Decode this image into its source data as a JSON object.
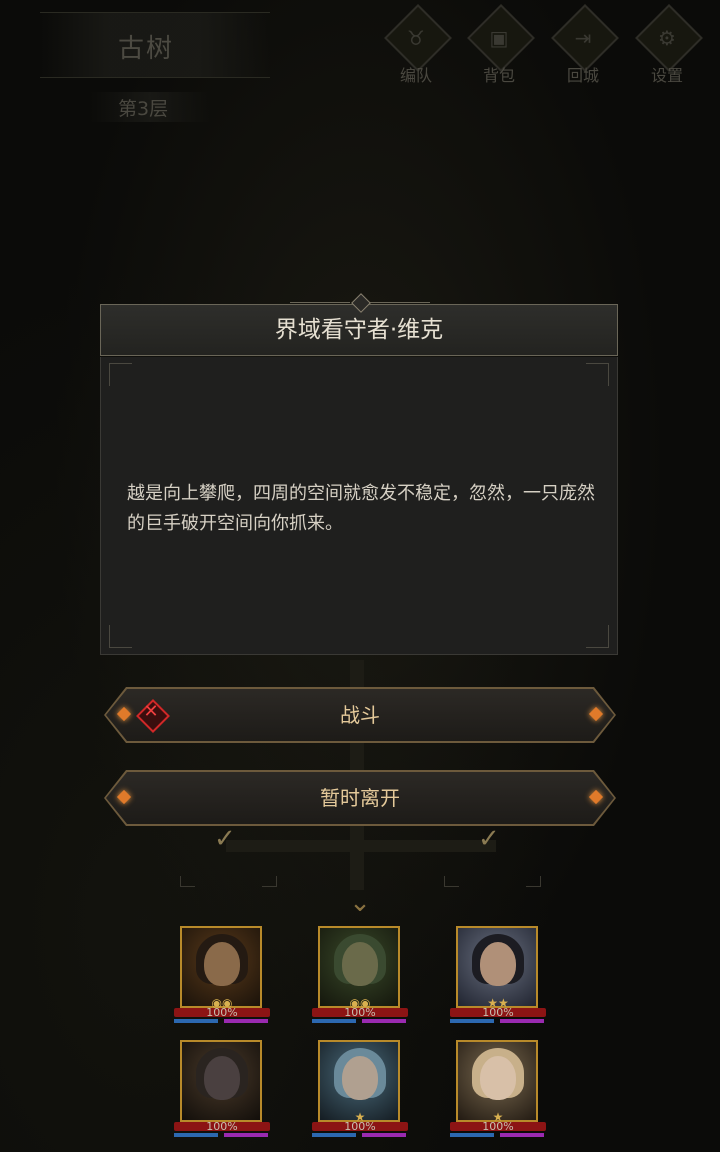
{
  "header": {
    "area_title": "古树",
    "floor": "第3层"
  },
  "menu": [
    {
      "label": "编队",
      "icon": "bull-helmet-icon"
    },
    {
      "label": "背包",
      "icon": "bag-icon"
    },
    {
      "label": "回城",
      "icon": "return-door-icon"
    },
    {
      "label": "设置",
      "icon": "gear-icon"
    }
  ],
  "dialog": {
    "title": "界域看守者·维克",
    "text": "越是向上攀爬，四周的空间就愈发不稳定，忽然，一只庞然的巨手破开空间向你抓来。"
  },
  "actions": {
    "fight": "战斗",
    "leave": "暂时离开"
  },
  "team": [
    {
      "hp": "100%"
    },
    {
      "hp": "100%"
    },
    {
      "hp": "100%"
    },
    {
      "hp": "100%"
    },
    {
      "hp": "100%"
    },
    {
      "hp": "100%"
    }
  ],
  "colors": {
    "accent_gold": "#e4c99a",
    "hp_red": "#8c1414",
    "mana_blue": "#2c68b0",
    "mana_purple": "#9a2ab0",
    "fight_red": "#d02828"
  }
}
